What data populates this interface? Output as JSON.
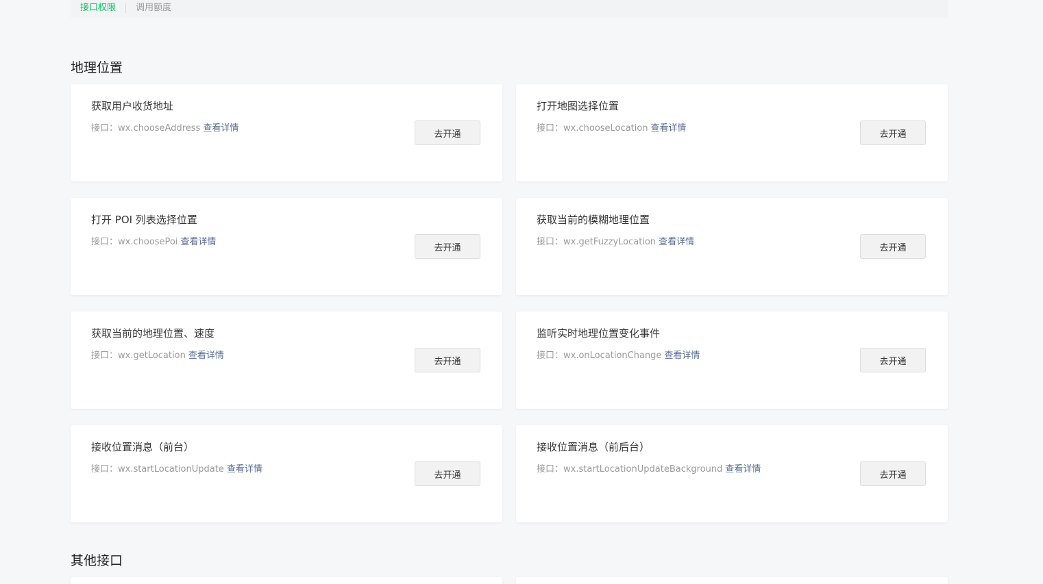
{
  "tabs": [
    {
      "label": "接口权限",
      "active": true
    },
    {
      "label": "调用额度",
      "active": false
    }
  ],
  "sections": [
    {
      "title": "地理位置",
      "cards": [
        {
          "title": "获取用户收货地址",
          "api_prefix": "接口：",
          "api": "wx.chooseAddress",
          "link": "查看详情",
          "button": "去开通"
        },
        {
          "title": "打开地图选择位置",
          "api_prefix": "接口：",
          "api": "wx.chooseLocation",
          "link": "查看详情",
          "button": "去开通"
        },
        {
          "title": "打开 POI 列表选择位置",
          "api_prefix": "接口：",
          "api": "wx.choosePoi",
          "link": "查看详情",
          "button": "去开通"
        },
        {
          "title": "获取当前的模糊地理位置",
          "api_prefix": "接口：",
          "api": "wx.getFuzzyLocation",
          "link": "查看详情",
          "button": "去开通"
        },
        {
          "title": "获取当前的地理位置、速度",
          "api_prefix": "接口：",
          "api": "wx.getLocation",
          "link": "查看详情",
          "button": "去开通"
        },
        {
          "title": "监听实时地理位置变化事件",
          "api_prefix": "接口：",
          "api": "wx.onLocationChange",
          "link": "查看详情",
          "button": "去开通"
        },
        {
          "title": "接收位置消息（前台）",
          "api_prefix": "接口：",
          "api": "wx.startLocationUpdate",
          "link": "查看详情",
          "button": "去开通"
        },
        {
          "title": "接收位置消息（前后台）",
          "api_prefix": "接口：",
          "api": "wx.startLocationUpdateBackground",
          "link": "查看详情",
          "button": "去开通"
        }
      ]
    },
    {
      "title": "其他接口"
    }
  ],
  "colors": {
    "accent": "#07c160",
    "link": "#576b95",
    "background": "#f6f7f9"
  }
}
